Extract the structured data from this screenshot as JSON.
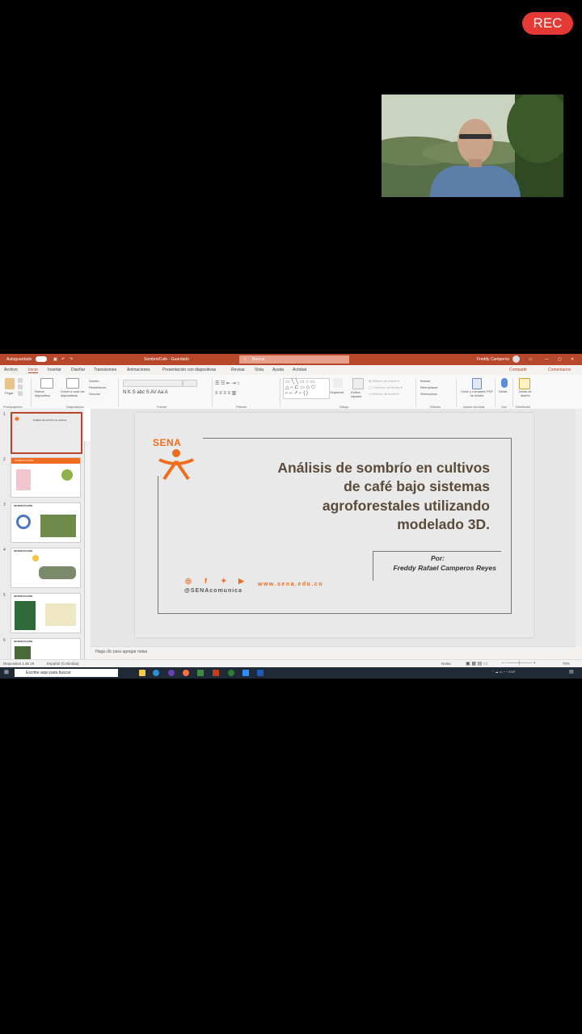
{
  "recording": {
    "label": "REC"
  },
  "window": {
    "autosave_label": "Autoguardado",
    "file_name": "SombrioCafe - Guardado",
    "search_placeholder": "Buscar",
    "user_name": "Freddy Camperos"
  },
  "menu": [
    "Archivo",
    "Inicio",
    "Insertar",
    "Diseñar",
    "Transiciones",
    "Animaciones",
    "Presentación con diapositivas",
    "Revisar",
    "Vista",
    "Ayuda",
    "Acrobat"
  ],
  "menu_right": {
    "share": "Compartir",
    "comments": "Comentarios"
  },
  "ribbon_groups": [
    "Portapapeles",
    "Diapositivas",
    "Fuente",
    "Párrafo",
    "Dibujo",
    "Edición",
    "Adobe Acrobat",
    "Voz",
    "Diseñador"
  ],
  "ribbon_buttons": {
    "paste": "Pegar",
    "new_slide": "Nueva diapositiva",
    "reuse": "Volver a usar las diapositivas",
    "layout": "Diseño",
    "reset": "Restablecer",
    "section": "Sección",
    "find": "Buscar",
    "replace": "Reemplazar",
    "select": "Seleccionar",
    "create_pdf": "Crear y compartir PDF de Adobe",
    "dictate": "Dictar",
    "design_ideas": "Ideas de diseño",
    "arrange": "Organizar",
    "quick_styles": "Estilos rápidos"
  },
  "thumbnails": [
    {
      "num": "1",
      "label": "Análisis de sombrío en cultivos"
    },
    {
      "num": "2",
      "label": "INTRODUCCIÓN"
    },
    {
      "num": "3",
      "label": "INTRODUCCIÓN"
    },
    {
      "num": "4",
      "label": "INTRODUCCIÓN"
    },
    {
      "num": "5",
      "label": "INTRODUCCIÓN"
    },
    {
      "num": "6",
      "label": "INTRODUCCIÓN"
    }
  ],
  "slide": {
    "logo_text": "SENA",
    "title_lines": [
      "Análisis de sombrío en cultivos",
      "de café bajo sistemas",
      "agroforestales utilizando",
      "modelado 3D."
    ],
    "author_prefix": "Por:",
    "author_name": "Freddy Rafael Camperos Reyes",
    "handle": "@SENAcomunica",
    "website": "www.sena.edu.co"
  },
  "notes_placeholder": "Haga clic para agregar notas",
  "status": {
    "slide_info": "Diapositiva 1 de 18",
    "language": "Español (Colombia)",
    "notes": "Notas",
    "zoom": "70%"
  },
  "taskbar": {
    "search_placeholder": "Escribe aquí para buscar"
  },
  "colors": {
    "accent": "#f06d1f",
    "title_text": "#5a4a3a",
    "ppt_red": "#b7472a"
  }
}
